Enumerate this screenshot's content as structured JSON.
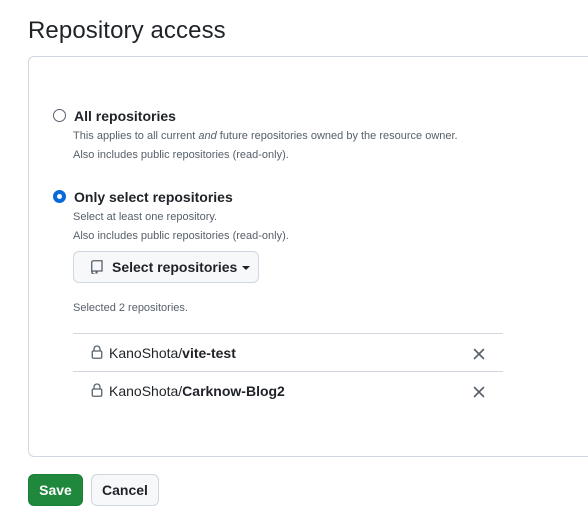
{
  "section": {
    "title": "Repository access"
  },
  "options": {
    "all": {
      "label": "All repositories",
      "desc_prefix": "This applies to all current ",
      "desc_emphasis": "and",
      "desc_suffix": " future repositories owned by the resource owner.",
      "desc_line2": "Also includes public repositories (read-only).",
      "selected": false
    },
    "select": {
      "label": "Only select repositories",
      "desc_line1": "Select at least one repository.",
      "desc_line2": "Also includes public repositories (read-only).",
      "selected": true
    }
  },
  "select_button": {
    "label": "Select repositories",
    "icon": "repo-icon"
  },
  "selection": {
    "count_text": "Selected 2 repositories.",
    "repos": [
      {
        "owner": "KanoShota/",
        "name": "vite-test",
        "icon": "lock-icon"
      },
      {
        "owner": "KanoShota/",
        "name": "Carknow-Blog2",
        "icon": "lock-icon"
      }
    ]
  },
  "actions": {
    "save_label": "Save",
    "cancel_label": "Cancel"
  },
  "colors": {
    "primary": "#1f883d",
    "accent": "#0969da",
    "border": "#d0d7de",
    "muted": "#57606a"
  }
}
